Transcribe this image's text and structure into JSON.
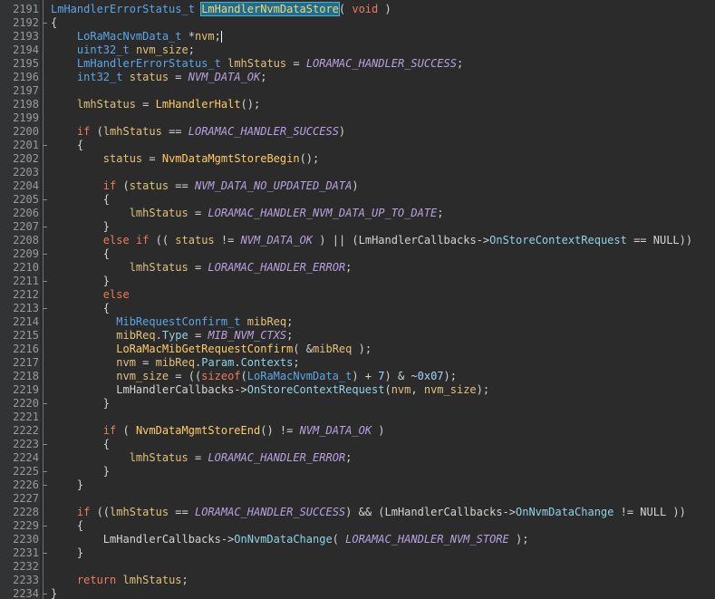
{
  "editor": {
    "line_numbers": [
      "2191",
      "2192",
      "2193",
      "2194",
      "2195",
      "2196",
      "2197",
      "2198",
      "2199",
      "2200",
      "2201",
      "2202",
      "2203",
      "2204",
      "2205",
      "2206",
      "2207",
      "2208",
      "2209",
      "2210",
      "2211",
      "2212",
      "2213",
      "2214",
      "2215",
      "2216",
      "2217",
      "2218",
      "2219",
      "2220",
      "2221",
      "2222",
      "2223",
      "2224",
      "2225",
      "2226",
      "2227",
      "2228",
      "2229",
      "2230",
      "2231",
      "2232",
      "2233",
      "2234"
    ],
    "lines": [
      [
        {
          "t": "LmHandlerErrorStatus_t",
          "c": "ty"
        },
        {
          "t": " "
        },
        {
          "t": "LmHandlerNvmDataStore",
          "c": "hl"
        },
        {
          "t": "( "
        },
        {
          "t": "void",
          "c": "kw"
        },
        {
          "t": " )"
        }
      ],
      [
        {
          "t": "{"
        }
      ],
      [
        {
          "t": "    "
        },
        {
          "t": "LoRaMacNvmData_t",
          "c": "ty"
        },
        {
          "t": " *"
        },
        {
          "t": "nvm",
          "c": "var"
        },
        {
          "t": ";"
        },
        {
          "t": "|",
          "c": "caret"
        }
      ],
      [
        {
          "t": "    "
        },
        {
          "t": "uint32_t",
          "c": "ty"
        },
        {
          "t": " "
        },
        {
          "t": "nvm_size",
          "c": "var"
        },
        {
          "t": ";"
        }
      ],
      [
        {
          "t": "    "
        },
        {
          "t": "LmHandlerErrorStatus_t",
          "c": "ty"
        },
        {
          "t": " "
        },
        {
          "t": "lmhStatus",
          "c": "var"
        },
        {
          "t": " = "
        },
        {
          "t": "LORAMAC_HANDLER_SUCCESS",
          "c": "mac"
        },
        {
          "t": ";"
        }
      ],
      [
        {
          "t": "    "
        },
        {
          "t": "int32_t",
          "c": "ty"
        },
        {
          "t": " "
        },
        {
          "t": "status",
          "c": "var"
        },
        {
          "t": " = "
        },
        {
          "t": "NVM_DATA_OK",
          "c": "mac"
        },
        {
          "t": ";"
        }
      ],
      [],
      [
        {
          "t": "    "
        },
        {
          "t": "lmhStatus",
          "c": "var"
        },
        {
          "t": " = "
        },
        {
          "t": "LmHandlerHalt",
          "c": "fn"
        },
        {
          "t": "();"
        }
      ],
      [],
      [
        {
          "t": "    "
        },
        {
          "t": "if",
          "c": "kw"
        },
        {
          "t": " ("
        },
        {
          "t": "lmhStatus",
          "c": "var"
        },
        {
          "t": " == "
        },
        {
          "t": "LORAMAC_HANDLER_SUCCESS",
          "c": "mac"
        },
        {
          "t": ")"
        }
      ],
      [
        {
          "t": "    {"
        }
      ],
      [
        {
          "t": "        "
        },
        {
          "t": "status",
          "c": "var"
        },
        {
          "t": " = "
        },
        {
          "t": "NvmDataMgmtStoreBegin",
          "c": "fn"
        },
        {
          "t": "();"
        }
      ],
      [],
      [
        {
          "t": "        "
        },
        {
          "t": "if",
          "c": "kw"
        },
        {
          "t": " ("
        },
        {
          "t": "status",
          "c": "var"
        },
        {
          "t": " == "
        },
        {
          "t": "NVM_DATA_NO_UPDATED_DATA",
          "c": "mac"
        },
        {
          "t": ")"
        }
      ],
      [
        {
          "t": "        {"
        }
      ],
      [
        {
          "t": "            "
        },
        {
          "t": "lmhStatus",
          "c": "var"
        },
        {
          "t": " = "
        },
        {
          "t": "LORAMAC_HANDLER_NVM_DATA_UP_TO_DATE",
          "c": "mac"
        },
        {
          "t": ";"
        }
      ],
      [
        {
          "t": "        }"
        }
      ],
      [
        {
          "t": "        "
        },
        {
          "t": "else",
          "c": "kw"
        },
        {
          "t": " "
        },
        {
          "t": "if",
          "c": "kw"
        },
        {
          "t": " (( "
        },
        {
          "t": "status",
          "c": "var"
        },
        {
          "t": " != "
        },
        {
          "t": "NVM_DATA_OK",
          "c": "mac"
        },
        {
          "t": " ) || (LmHandlerCallbacks->"
        },
        {
          "t": "OnStoreContextRequest",
          "c": "mem"
        },
        {
          "t": " == NULL))"
        }
      ],
      [
        {
          "t": "        {"
        }
      ],
      [
        {
          "t": "            "
        },
        {
          "t": "lmhStatus",
          "c": "var"
        },
        {
          "t": " = "
        },
        {
          "t": "LORAMAC_HANDLER_ERROR",
          "c": "mac"
        },
        {
          "t": ";"
        }
      ],
      [
        {
          "t": "        }"
        }
      ],
      [
        {
          "t": "        "
        },
        {
          "t": "else",
          "c": "kw"
        }
      ],
      [
        {
          "t": "        {"
        }
      ],
      [
        {
          "t": "          "
        },
        {
          "t": "MibRequestConfirm_t",
          "c": "ty"
        },
        {
          "t": " "
        },
        {
          "t": "mibReq",
          "c": "var"
        },
        {
          "t": ";"
        }
      ],
      [
        {
          "t": "          "
        },
        {
          "t": "mibReq",
          "c": "var"
        },
        {
          "t": "."
        },
        {
          "t": "Type",
          "c": "mem"
        },
        {
          "t": " = "
        },
        {
          "t": "MIB_NVM_CTXS",
          "c": "mac"
        },
        {
          "t": ";"
        }
      ],
      [
        {
          "t": "          "
        },
        {
          "t": "LoRaMacMibGetRequestConfirm",
          "c": "fn"
        },
        {
          "t": "( &"
        },
        {
          "t": "mibReq",
          "c": "var"
        },
        {
          "t": " );"
        }
      ],
      [
        {
          "t": "          "
        },
        {
          "t": "nvm",
          "c": "var"
        },
        {
          "t": " = "
        },
        {
          "t": "mibReq",
          "c": "var"
        },
        {
          "t": "."
        },
        {
          "t": "Param",
          "c": "mem"
        },
        {
          "t": "."
        },
        {
          "t": "Contexts",
          "c": "mem"
        },
        {
          "t": ";"
        }
      ],
      [
        {
          "t": "          "
        },
        {
          "t": "nvm_size",
          "c": "var"
        },
        {
          "t": " = (("
        },
        {
          "t": "sizeof",
          "c": "kw"
        },
        {
          "t": "("
        },
        {
          "t": "LoRaMacNvmData_t",
          "c": "ty"
        },
        {
          "t": ") + "
        },
        {
          "t": "7",
          "c": "num-lit"
        },
        {
          "t": ") & ~"
        },
        {
          "t": "0x07",
          "c": "num-lit"
        },
        {
          "t": ");"
        }
      ],
      [
        {
          "t": "          LmHandlerCallbacks->"
        },
        {
          "t": "OnStoreContextRequest",
          "c": "mem"
        },
        {
          "t": "("
        },
        {
          "t": "nvm",
          "c": "var"
        },
        {
          "t": ", "
        },
        {
          "t": "nvm_size",
          "c": "var"
        },
        {
          "t": ");"
        }
      ],
      [
        {
          "t": "        }"
        }
      ],
      [],
      [
        {
          "t": "        "
        },
        {
          "t": "if",
          "c": "kw"
        },
        {
          "t": " ( "
        },
        {
          "t": "NvmDataMgmtStoreEnd",
          "c": "fn"
        },
        {
          "t": "() != "
        },
        {
          "t": "NVM_DATA_OK",
          "c": "mac"
        },
        {
          "t": " )"
        }
      ],
      [
        {
          "t": "        {"
        }
      ],
      [
        {
          "t": "            "
        },
        {
          "t": "lmhStatus",
          "c": "var"
        },
        {
          "t": " = "
        },
        {
          "t": "LORAMAC_HANDLER_ERROR",
          "c": "mac"
        },
        {
          "t": ";"
        }
      ],
      [
        {
          "t": "        }"
        }
      ],
      [
        {
          "t": "    }"
        }
      ],
      [],
      [
        {
          "t": "    "
        },
        {
          "t": "if",
          "c": "kw"
        },
        {
          "t": " (("
        },
        {
          "t": "lmhStatus",
          "c": "var"
        },
        {
          "t": " == "
        },
        {
          "t": "LORAMAC_HANDLER_SUCCESS",
          "c": "mac"
        },
        {
          "t": ") && (LmHandlerCallbacks->"
        },
        {
          "t": "OnNvmDataChange",
          "c": "mem"
        },
        {
          "t": " != NULL ))"
        }
      ],
      [
        {
          "t": "    {"
        }
      ],
      [
        {
          "t": "        LmHandlerCallbacks->"
        },
        {
          "t": "OnNvmDataChange",
          "c": "mem"
        },
        {
          "t": "( "
        },
        {
          "t": "LORAMAC_HANDLER_NVM_STORE",
          "c": "mac"
        },
        {
          "t": " );"
        }
      ],
      [
        {
          "t": "    }"
        }
      ],
      [],
      [
        {
          "t": "    "
        },
        {
          "t": "return",
          "c": "kw"
        },
        {
          "t": " "
        },
        {
          "t": "lmhStatus",
          "c": "var"
        },
        {
          "t": ";"
        }
      ],
      [
        {
          "t": "}"
        }
      ]
    ]
  },
  "colors": {
    "background": "#2b2b2b",
    "gutter": "#313335",
    "type": "#5aa7e8",
    "keyword": "#ee7a5a",
    "function": "#ffcc66",
    "macro": "#b9a2e0",
    "highlight": "#1d6e8f"
  }
}
